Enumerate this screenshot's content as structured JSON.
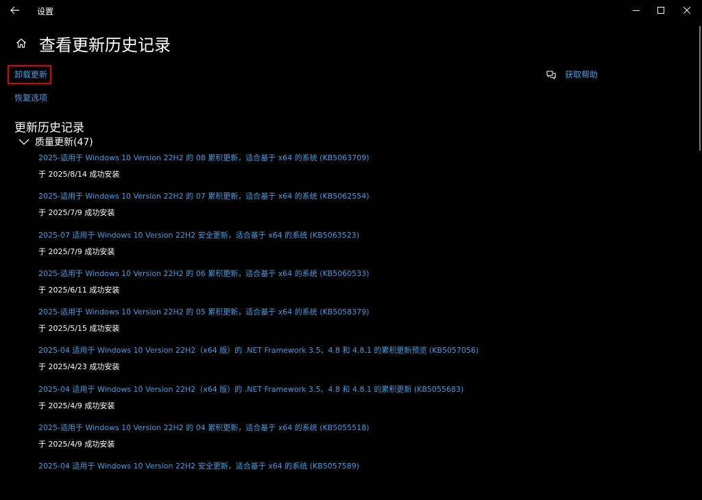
{
  "window": {
    "title": "设置"
  },
  "page": {
    "title": "查看更新历史记录"
  },
  "links": {
    "uninstall": "卸载更新",
    "recovery": "恢复选项",
    "help": "获取帮助"
  },
  "section": {
    "title": "更新历史记录"
  },
  "category": {
    "label": "质量更新(47)"
  },
  "updates": [
    {
      "title": "2025-适用于 Windows 10 Version 22H2 的 08 累积更新，适合基于 x64 的系统 (KB5063709)",
      "status": "于 2025/8/14 成功安装"
    },
    {
      "title": "2025-适用于 Windows 10 Version 22H2 的 07 累积更新，适合基于 x64 的系统 (KB5062554)",
      "status": "于 2025/7/9 成功安装"
    },
    {
      "title": "2025-07 适用于 Windows 10 Version 22H2 安全更新，适合基于 x64 的系统 (KB5063523)",
      "status": "于 2025/7/9 成功安装"
    },
    {
      "title": "2025-适用于 Windows 10 Version 22H2 的 06 累积更新，适合基于 x64 的系统 (KB5060533)",
      "status": "于 2025/6/11 成功安装"
    },
    {
      "title": "2025-适用于 Windows 10 Version 22H2 的 05 累积更新，适合基于 x64 的系统 (KB5058379)",
      "status": "于 2025/5/15 成功安装"
    },
    {
      "title": "2025-04 适用于 Windows 10 Version 22H2（x64 版）的 .NET Framework 3.5、4.8 和 4.8.1 的累积更新预览 (KB5057056)",
      "status": "于 2025/4/23 成功安装"
    },
    {
      "title": "2025-04 适用于 Windows 10 Version 22H2（x64 版）的 .NET Framework 3.5、4.8 和 4.8.1 的累积更新 (KB5055683)",
      "status": "于 2025/4/9 成功安装"
    },
    {
      "title": "2025-适用于 Windows 10 Version 22H2 的 04 累积更新，适合基于 x64 的系统 (KB5055518)",
      "status": "于 2025/4/9 成功安装"
    },
    {
      "title": "2025-04 适用于 Windows 10 Version 22H2 安全更新，适合基于 x64 的系统 (KB5057589)",
      "status": ""
    }
  ],
  "icons": {
    "back": "back-arrow-icon",
    "minimize": "minimize-icon",
    "maximize": "maximize-icon",
    "close": "close-icon",
    "home": "home-icon",
    "help": "help-chat-icon",
    "expand": "chevron-down-icon"
  },
  "colors": {
    "background": "#000000",
    "link": "#3c9fe8",
    "highlight_box": "#e00000",
    "text": "#ffffff"
  }
}
